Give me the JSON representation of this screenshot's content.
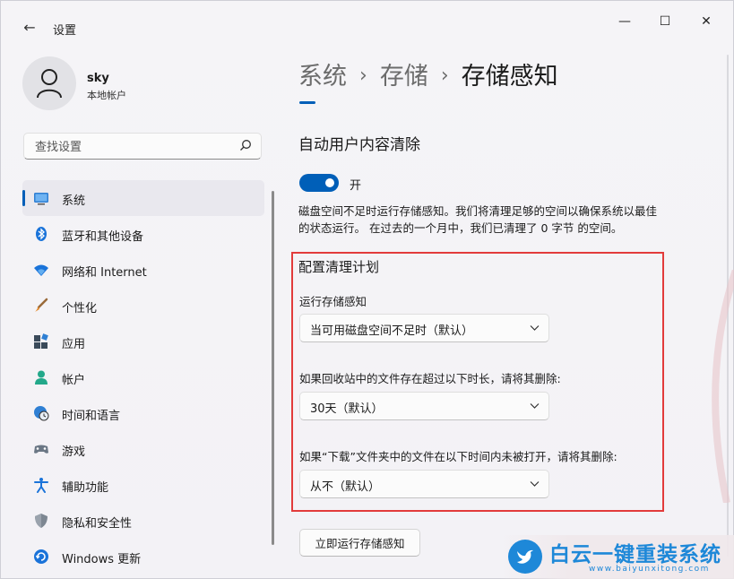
{
  "window": {
    "title": "设置",
    "back_glyph": "←",
    "minimize_glyph": "—",
    "maximize_glyph": "☐",
    "close_glyph": "✕"
  },
  "profile": {
    "name": "sky",
    "account_type": "本地帐户"
  },
  "search": {
    "placeholder": "查找设置"
  },
  "sidebar": {
    "items": [
      {
        "label": "系统",
        "icon": "monitor-icon",
        "active": true
      },
      {
        "label": "蓝牙和其他设备",
        "icon": "bluetooth-icon"
      },
      {
        "label": "网络和 Internet",
        "icon": "wifi-icon"
      },
      {
        "label": "个性化",
        "icon": "brush-icon"
      },
      {
        "label": "应用",
        "icon": "apps-icon"
      },
      {
        "label": "帐户",
        "icon": "person-icon"
      },
      {
        "label": "时间和语言",
        "icon": "globe-clock-icon"
      },
      {
        "label": "游戏",
        "icon": "gamepad-icon"
      },
      {
        "label": "辅助功能",
        "icon": "accessibility-icon"
      },
      {
        "label": "隐私和安全性",
        "icon": "shield-icon"
      },
      {
        "label": "Windows 更新",
        "icon": "update-icon"
      }
    ]
  },
  "breadcrumb": {
    "items": [
      "系统",
      "存储",
      "存储感知"
    ],
    "separator": "›"
  },
  "main": {
    "section_title": "自动用户内容清除",
    "toggle": {
      "state": "on",
      "label": "开"
    },
    "description": [
      "磁盘空间不足时运行存储感知。我们将清理足够的空间以确保系统以最佳",
      "的状态运行。 在过去的一个月中，我们已清理了 0 字节 的空间。"
    ],
    "plan": {
      "title": "配置清理计划",
      "run_label": "运行存储感知",
      "run_value": "当可用磁盘空间不足时（默认）",
      "recycle_label": "如果回收站中的文件存在超过以下时长，请将其删除:",
      "recycle_value": "30天（默认）",
      "downloads_label": "如果“下载”文件夹中的文件在以下时间内未被打开，请将其删除:",
      "downloads_value": "从不（默认）"
    },
    "run_now_label": "立即运行存储感知"
  },
  "watermark": {
    "text": "白云一键重装系统",
    "url": "www.baiyunxitong.com"
  },
  "colors": {
    "accent": "#005fb8",
    "highlight_frame": "#e23b3b",
    "watermark": "#1e88d8"
  }
}
